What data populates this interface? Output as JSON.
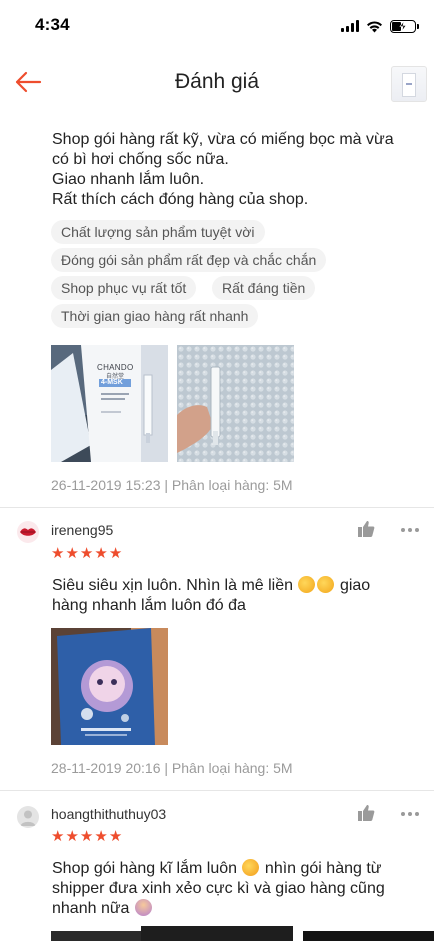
{
  "status_bar": {
    "time": "4:34"
  },
  "header": {
    "title": "Đánh giá"
  },
  "review1": {
    "text_lines": [
      "Shop gói hàng rất kỹ, vừa có miếng bọc mà vừa",
      "có bì hơi chống sốc nữa.",
      "Giao nhanh lắm luôn.",
      "Rất thích cách đóng hàng của shop."
    ],
    "tags": [
      "Chất lượng sản phẩm tuyệt vời",
      "Đóng gói sản phẩm rất đẹp và chắc chắn",
      "Shop phục vụ rất tốt",
      "Rất đáng tiền",
      "Thời gian giao hàng rất nhanh"
    ],
    "photo_brand": "CHANDO",
    "photo_brand_sub": "自然堂",
    "photo_product": "4-MSK",
    "date": "26-11-2019 15:23",
    "variation_prefix": "Phân loại hàng:",
    "variation": "5M"
  },
  "review2": {
    "username": "ireneng95",
    "rating": 5,
    "text_part1": "Siêu siêu xịn luôn. Nhìn là mê liền",
    "text_part2": "giao",
    "text_line2": "hàng nhanh lắm luôn đó đa",
    "date": "28-11-2019 20:16",
    "variation_prefix": "Phân loại hàng:",
    "variation": "5M"
  },
  "review3": {
    "username": "hoangthithuthuy03",
    "rating": 5,
    "text_part1": "Shop gói hàng kĩ lắm luôn",
    "text_part2": "nhìn gói hàng từ",
    "text_line2": "shipper đưa xinh xẻo cực kì và  giao hàng cũng",
    "text_line3": "nhanh nữa"
  },
  "colors": {
    "accent": "#ee4d2d",
    "text": "#222222",
    "muted": "#9b9b9b",
    "tag_bg": "#f3f3f3"
  },
  "icons": {
    "back": "arrow-left-icon",
    "like": "thumbs-up-icon",
    "more": "more-horizontal-icon",
    "star": "star-icon"
  }
}
